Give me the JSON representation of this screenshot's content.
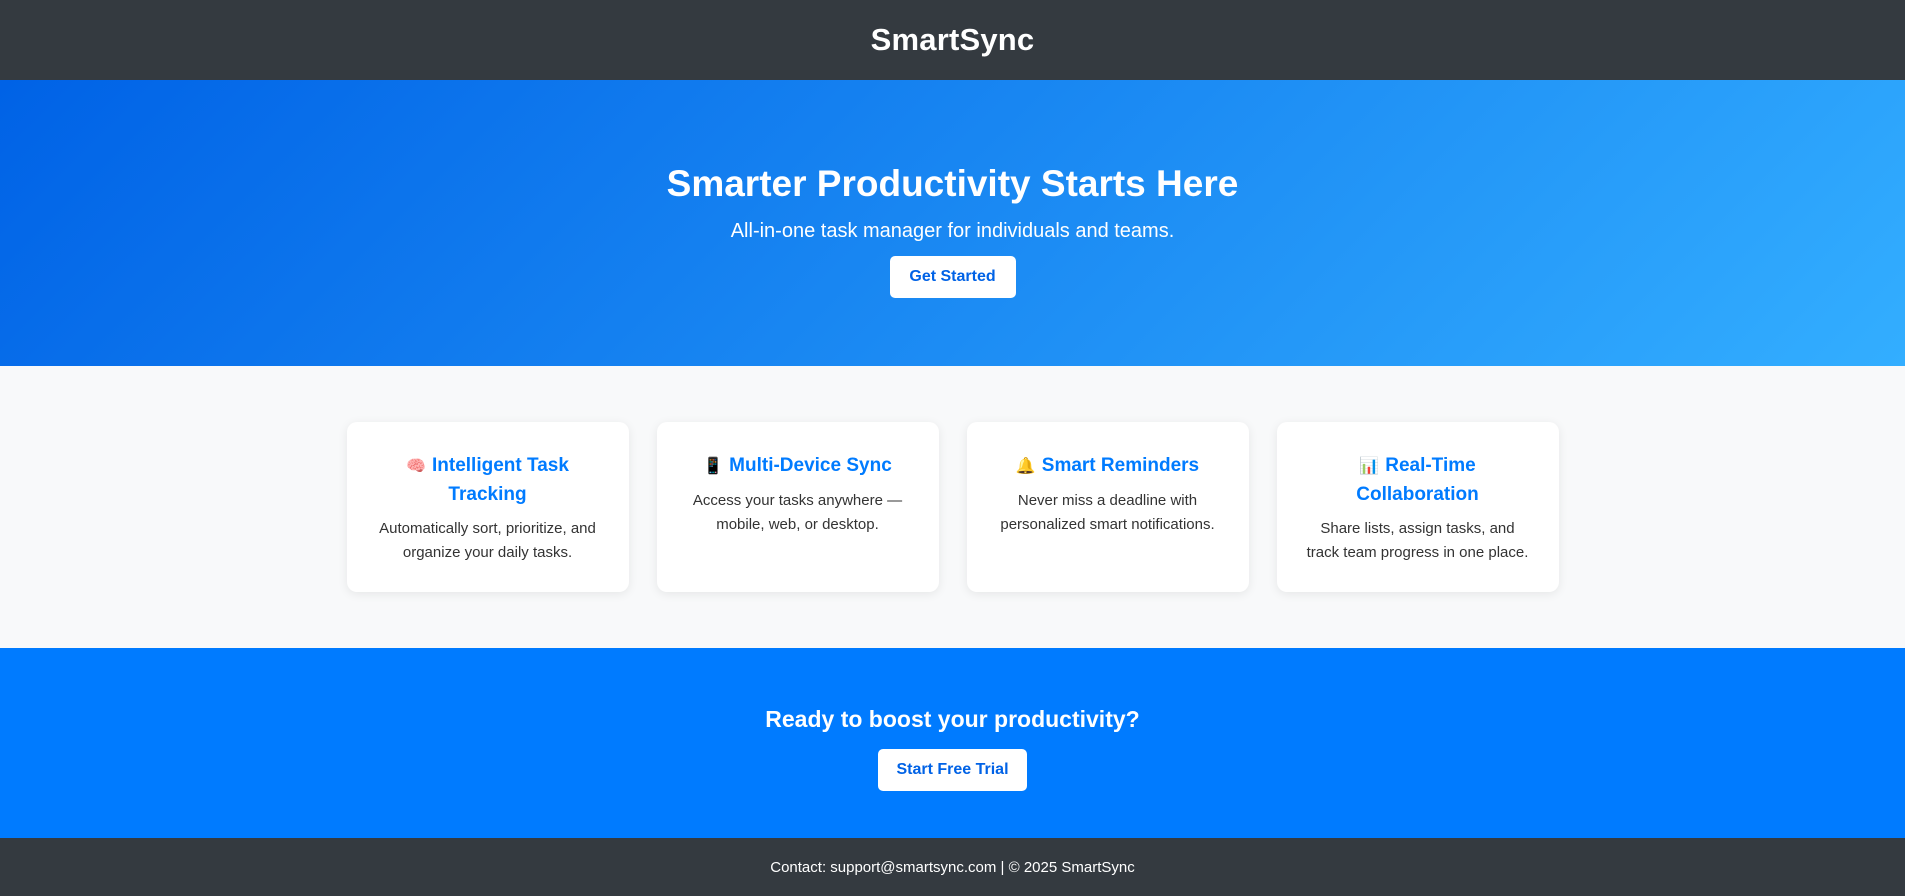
{
  "header": {
    "brand": "SmartSync"
  },
  "hero": {
    "title": "Smarter Productivity Starts Here",
    "subtitle": "All-in-one task manager for individuals and teams.",
    "cta_label": "Get Started"
  },
  "features": [
    {
      "icon": "🧠",
      "icon_name": "brain-icon",
      "title": "Intelligent Task Tracking",
      "text": "Automatically sort, prioritize, and organize your daily tasks."
    },
    {
      "icon": "📱",
      "icon_name": "mobile-phone-icon",
      "title": "Multi-Device Sync",
      "text": "Access your tasks anywhere — mobile, web, or desktop."
    },
    {
      "icon": "🔔",
      "icon_name": "bell-icon",
      "title": "Smart Reminders",
      "text": "Never miss a deadline with personalized smart notifications."
    },
    {
      "icon": "📊",
      "icon_name": "bar-chart-icon",
      "title": "Real-Time Collaboration",
      "text": "Share lists, assign tasks, and track team progress in one place."
    }
  ],
  "cta": {
    "title": "Ready to boost your productivity?",
    "button_label": "Start Free Trial"
  },
  "footer": {
    "text": "Contact: support@smartsync.com | © 2025 SmartSync"
  },
  "colors": {
    "topbar": "#343a40",
    "hero_gradient_start": "#0062e6",
    "hero_gradient_end": "#33aeff",
    "accent": "#007bff",
    "background": "#f8f9fa"
  }
}
